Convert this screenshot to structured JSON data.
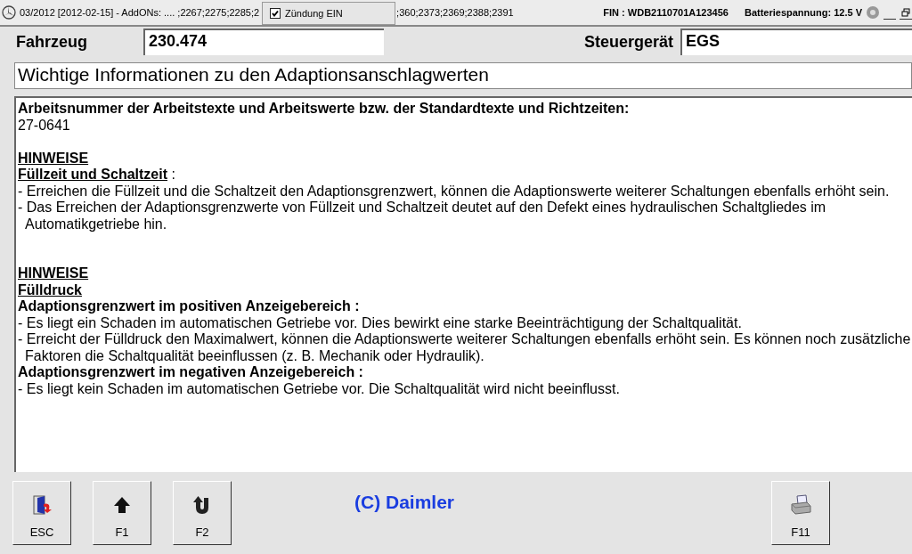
{
  "title_bar": {
    "text_before": "03/2012 [2012-02-15] - AddONs:  .... ;2267;2275;2285;2",
    "text_after": ";360;2373;2369;2388;2391",
    "fin": "FIN : WDB2110701A123456",
    "battery": "Batteriespannung: 12.5 V"
  },
  "ignition_popup": {
    "label": "Zündung EIN",
    "checked": true
  },
  "vehicle": {
    "label": "Fahrzeug",
    "value": "230.474"
  },
  "control_unit": {
    "label": "Steuergerät",
    "value": "EGS"
  },
  "heading": "Wichtige Informationen zu den Adaptionsanschlagwerten",
  "content": [
    {
      "kind": "bold",
      "text": "Arbeitsnummer der Arbeitstexte und Arbeitswerte bzw. der Standardtexte und Richtzeiten:"
    },
    {
      "kind": "text",
      "text": "27-0641"
    },
    {
      "kind": "blank"
    },
    {
      "kind": "heading",
      "text": "HINWEISE"
    },
    {
      "kind": "underline",
      "text": "Füllzeit und Schaltzeit",
      "suffix": " :"
    },
    {
      "kind": "bullet",
      "text": "- Erreichen die Füllzeit und die Schaltzeit den Adaptionsgrenzwert, können die Adaptionswerte weiterer Schaltungen ebenfalls erhöht sein."
    },
    {
      "kind": "bullet",
      "text": "- Das Erreichen der Adaptionsgrenzwerte von Füllzeit und Schaltzeit deutet auf den Defekt eines hydraulischen Schaltgliedes im Automatikgetriebe hin."
    },
    {
      "kind": "blank"
    },
    {
      "kind": "blank"
    },
    {
      "kind": "heading",
      "text": "HINWEISE"
    },
    {
      "kind": "heading",
      "text": "Fülldruck"
    },
    {
      "kind": "bold",
      "text": "Adaptionsgrenzwert im positiven Anzeigebereich :"
    },
    {
      "kind": "bullet",
      "text": "- Es liegt ein Schaden im automatischen Getriebe vor. Dies bewirkt eine starke Beeinträchtigung der Schaltqualität."
    },
    {
      "kind": "bullet",
      "text": "- Erreicht der Fülldruck den Maximalwert, können die Adaptionswerte weiterer Schaltungen ebenfalls erhöht sein. Es können noch zusätzliche Faktoren die Schaltqualität beeinflussen (z. B. Mechanik oder Hydraulik)."
    },
    {
      "kind": "bold",
      "text": "Adaptionsgrenzwert im negativen Anzeigebereich :"
    },
    {
      "kind": "bullet",
      "text": "- Es liegt kein Schaden im automatischen Getriebe vor. Die Schaltqualität wird nicht beeinflusst."
    }
  ],
  "buttons_left": [
    {
      "label": "ESC",
      "kind": "door"
    },
    {
      "label": "F1",
      "kind": "up"
    },
    {
      "label": "F2",
      "kind": "uturn"
    }
  ],
  "copyright": "(C) Daimler",
  "buttons_right": [
    {
      "label": "F11",
      "kind": "printer"
    }
  ]
}
